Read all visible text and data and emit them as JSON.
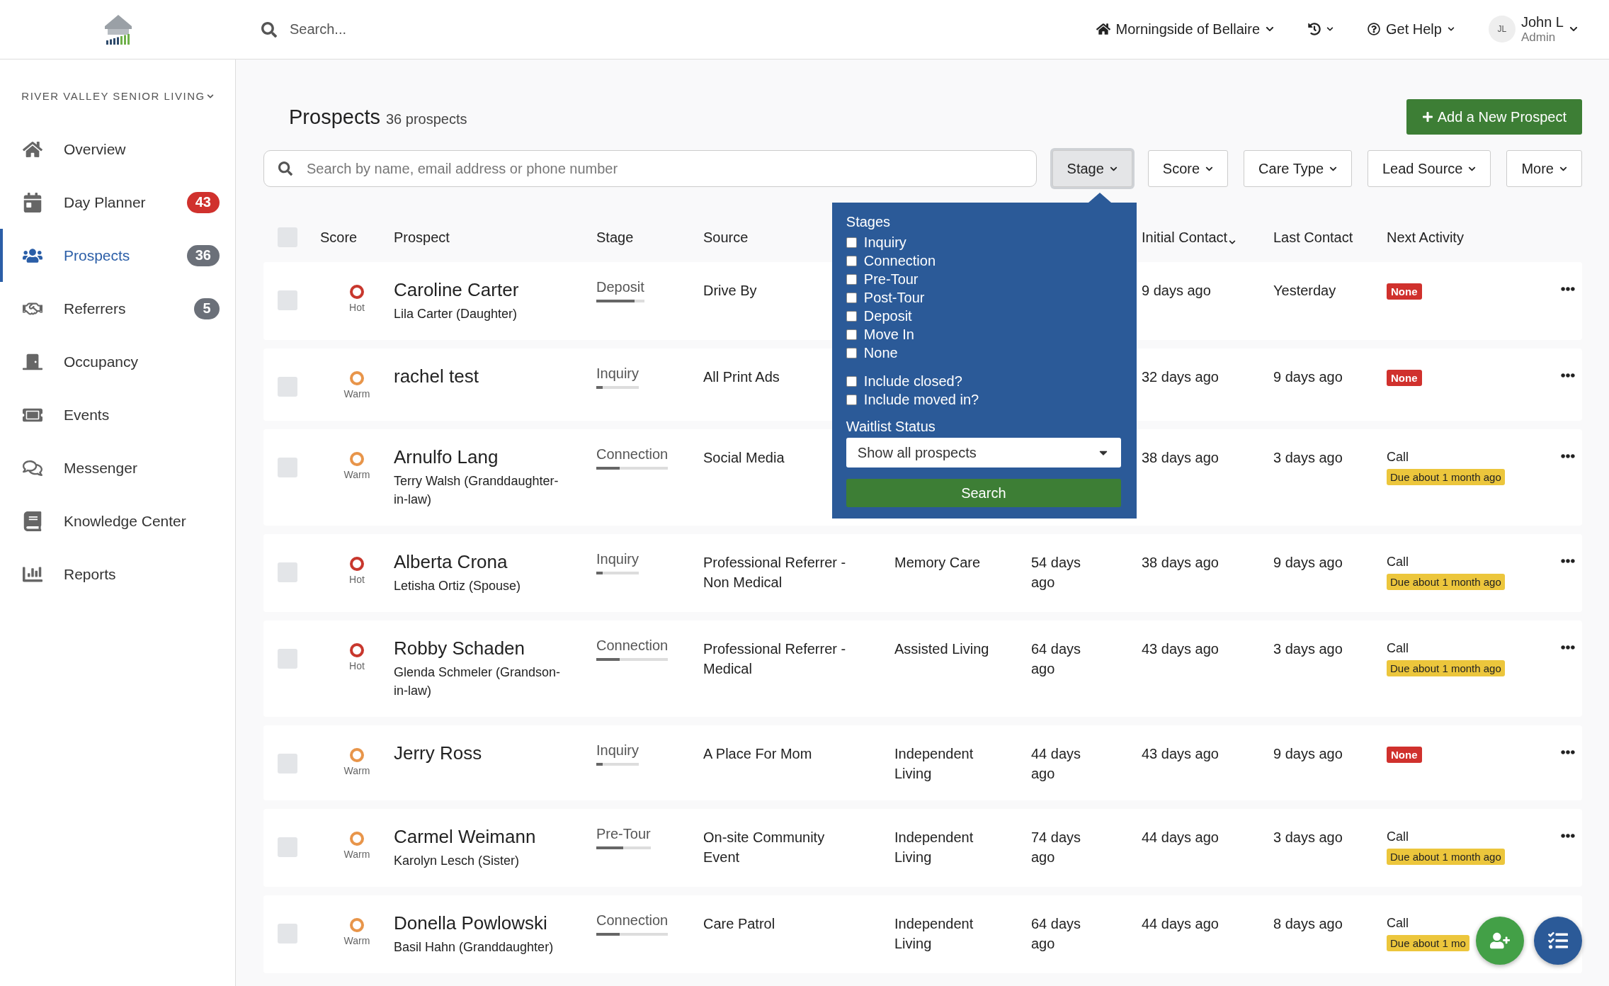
{
  "topbar": {
    "search": {
      "placeholder": "Search..."
    },
    "community": "Morningside of Bellaire",
    "help": "Get Help",
    "user": {
      "initials": "JL",
      "name": "John L",
      "role": "Admin"
    }
  },
  "sidebar": {
    "organization": "RIVER VALLEY SENIOR LIVING",
    "items": [
      {
        "label": "Overview",
        "selected": false
      },
      {
        "label": "Day Planner",
        "selected": false,
        "badge": {
          "text": "43",
          "color": "#d0312d"
        }
      },
      {
        "label": "Prospects",
        "selected": true,
        "badge": {
          "text": "36",
          "color": "#6b7079"
        }
      },
      {
        "label": "Referrers",
        "selected": false,
        "badge": {
          "text": "5",
          "color": "#6b7079"
        }
      },
      {
        "label": "Occupancy",
        "selected": false
      },
      {
        "label": "Events",
        "selected": false
      },
      {
        "label": "Messenger",
        "selected": false
      },
      {
        "label": "Knowledge Center",
        "selected": false
      },
      {
        "label": "Reports",
        "selected": false
      }
    ]
  },
  "page": {
    "title": "Prospects",
    "count": "36 prospects",
    "add_button": "Add a New Prospect"
  },
  "search": {
    "placeholder": "Search by name, email address or phone number"
  },
  "filters": [
    {
      "label": "Stage",
      "selected": true
    },
    {
      "label": "Score",
      "selected": false
    },
    {
      "label": "Care Type",
      "selected": false
    },
    {
      "label": "Lead Source",
      "selected": false
    },
    {
      "label": "More",
      "selected": false
    }
  ],
  "stage_popup": {
    "title": "Stages",
    "stages": [
      {
        "label": "Inquiry",
        "checked": false
      },
      {
        "label": "Connection",
        "checked": false
      },
      {
        "label": "Pre-Tour",
        "checked": false
      },
      {
        "label": "Post-Tour",
        "checked": false
      },
      {
        "label": "Deposit",
        "checked": false
      },
      {
        "label": "Move In",
        "checked": false
      },
      {
        "label": "None",
        "checked": false
      }
    ],
    "options": [
      {
        "label": "Include closed?",
        "checked": false
      },
      {
        "label": "Include moved in?",
        "checked": false
      }
    ],
    "waitlist_label": "Waitlist Status",
    "waitlist_value": "Show all prospects",
    "search_button": "Search"
  },
  "table": {
    "select_all_checked": false,
    "columns": [
      "Score",
      "Prospect",
      "Stage",
      "Source",
      "Initial Contact",
      "Last Contact",
      "Next Activity"
    ],
    "rows": [
      {
        "checked": false,
        "score": "Hot",
        "color": "#c8372d",
        "name": "Caroline Carter",
        "contact": "Lila Carter (Daughter)",
        "stage": "Deposit",
        "level": 0.8,
        "source": "Drive By",
        "initial": "9 days ago",
        "last": "Yesterday",
        "next": {
          "kind": "none",
          "badge": "None"
        }
      },
      {
        "checked": false,
        "score": "Warm",
        "color": "#e8954a",
        "name": "rachel test",
        "stage": "Inquiry",
        "level": 0.15,
        "source": "All Print Ads",
        "initial": "32 days ago",
        "last": "9 days ago",
        "next": {
          "kind": "none",
          "badge": "None"
        }
      },
      {
        "checked": false,
        "score": "Warm",
        "color": "#e8954a",
        "name": "Arnulfo Lang",
        "contact": "Terry Walsh (Granddaughter-in-law)",
        "stage": "Connection",
        "level": 0.33,
        "source": "Social Media",
        "initial": "38 days ago",
        "last": "3 days ago",
        "next": {
          "kind": "activity",
          "activity": "Call",
          "due": "Due about 1 month ago"
        }
      },
      {
        "checked": false,
        "score": "Hot",
        "color": "#c8372d",
        "name": "Alberta Crona",
        "contact": "Letisha Ortiz (Spouse)",
        "stage": "Inquiry",
        "level": 0.15,
        "source": "Professional Referrer - Non Medical",
        "care_type": "Memory Care",
        "days": "54 days ago",
        "initial": "38 days ago",
        "last": "9 days ago",
        "next": {
          "kind": "activity",
          "activity": "Call",
          "due": "Due about 1 month ago"
        }
      },
      {
        "checked": false,
        "score": "Hot",
        "color": "#c8372d",
        "name": "Robby Schaden",
        "contact": "Glenda Schmeler (Grandson-in-law)",
        "stage": "Connection",
        "level": 0.33,
        "source": "Professional Referrer - Medical",
        "care_type": "Assisted Living",
        "days": "64 days ago",
        "initial": "43 days ago",
        "last": "3 days ago",
        "next": {
          "kind": "activity",
          "activity": "Call",
          "due": "Due about 1 month ago"
        }
      },
      {
        "checked": false,
        "score": "Warm",
        "color": "#e8954a",
        "name": "Jerry Ross",
        "stage": "Inquiry",
        "level": 0.15,
        "source": "A Place For Mom",
        "care_type": "Independent Living",
        "days": "44 days ago",
        "initial": "43 days ago",
        "last": "9 days ago",
        "next": {
          "kind": "none",
          "badge": "None"
        }
      },
      {
        "checked": false,
        "score": "Warm",
        "color": "#e8954a",
        "name": "Carmel Weimann",
        "contact": "Karolyn Lesch (Sister)",
        "stage": "Pre-Tour",
        "level": 0.5,
        "source": "On-site Community Event",
        "care_type": "Independent Living",
        "days": "74 days ago",
        "initial": "44 days ago",
        "last": "3 days ago",
        "next": {
          "kind": "activity",
          "activity": "Call",
          "due": "Due about 1 month ago"
        }
      },
      {
        "checked": false,
        "score": "Warm",
        "color": "#e8954a",
        "name": "Donella Powlowski",
        "contact": "Basil Hahn (Granddaughter)",
        "stage": "Connection",
        "level": 0.33,
        "source": "Care Patrol",
        "care_type": "Independent Living",
        "days": "64 days ago",
        "initial": "44 days ago",
        "last": "8 days ago",
        "menu": false,
        "next": {
          "kind": "activity",
          "activity": "Call",
          "due": "Due about 1 mo"
        }
      }
    ]
  }
}
